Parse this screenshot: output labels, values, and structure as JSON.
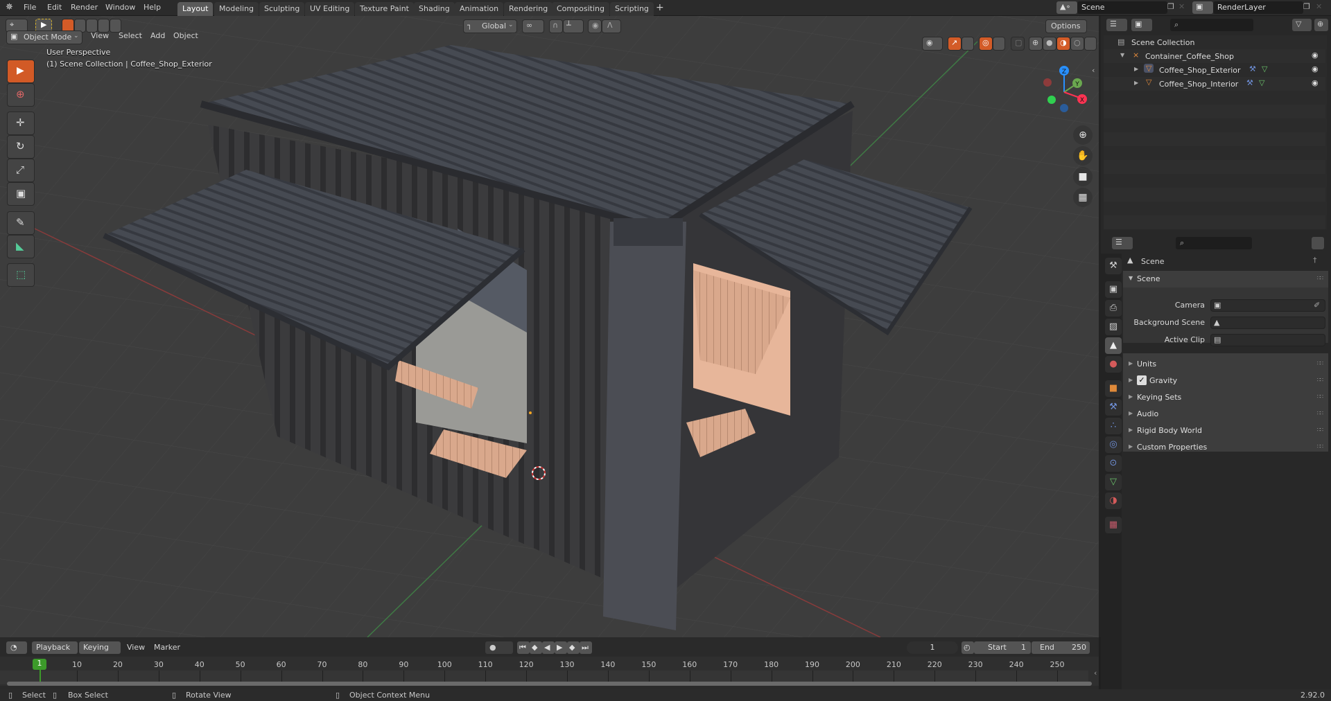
{
  "app": {
    "menu": [
      "File",
      "Edit",
      "Render",
      "Window",
      "Help"
    ],
    "workspaces": [
      "Layout",
      "Modeling",
      "Sculpting",
      "UV Editing",
      "Texture Paint",
      "Shading",
      "Animation",
      "Rendering",
      "Compositing",
      "Scripting"
    ],
    "active_workspace": "Layout",
    "add_workspace": "+",
    "scene_name": "Scene",
    "view_layer_name": "RenderLayer",
    "version": "2.92.0"
  },
  "viewport": {
    "mode": "Object Mode",
    "menus": [
      "View",
      "Select",
      "Add",
      "Object"
    ],
    "transform_orientation": "Global",
    "options_label": "Options",
    "overlay_line1": "User Perspective",
    "overlay_line2": "(1) Scene Collection | Coffee_Shop_Exterior",
    "gizmo_axes": {
      "x": "X",
      "y": "Y",
      "z": "Z"
    },
    "axis_colors": {
      "x": "#ff3352",
      "y": "#8bdc00",
      "z": "#2890ff"
    },
    "tools": [
      "select-box",
      "cursor",
      "move",
      "rotate",
      "scale",
      "transform",
      "annotate",
      "measure",
      "add-cube"
    ],
    "active_tool": "select-box",
    "nav_buttons": [
      "zoom",
      "pan",
      "camera-view",
      "ortho-toggle"
    ],
    "shading_mode": "material-preview"
  },
  "outliner": {
    "root": "Scene Collection",
    "items": [
      {
        "name": "Container_Coffee_Shop",
        "type": "empty",
        "expanded": true,
        "visible": true
      },
      {
        "name": "Coffee_Shop_Exterior",
        "type": "mesh",
        "expanded": false,
        "visible": true,
        "selected": true
      },
      {
        "name": "Coffee_Shop_Interior",
        "type": "mesh",
        "expanded": false,
        "visible": true
      }
    ]
  },
  "properties": {
    "context_title": "Scene",
    "panel_title": "Scene",
    "fields": [
      {
        "label": "Camera",
        "value": ""
      },
      {
        "label": "Background Scene",
        "value": ""
      },
      {
        "label": "Active Clip",
        "value": ""
      }
    ],
    "sub_panels": [
      "Units",
      "Gravity",
      "Keying Sets",
      "Audio",
      "Rigid Body World",
      "Custom Properties"
    ],
    "gravity_checked": true,
    "tabs": [
      "tool",
      "render",
      "output",
      "view-layer",
      "scene",
      "world",
      "object",
      "modifiers",
      "particles",
      "physics",
      "constraints",
      "data",
      "material",
      "texture"
    ],
    "active_tab": "scene"
  },
  "timeline": {
    "menus": [
      "Playback",
      "Keying",
      "View",
      "Marker"
    ],
    "current_frame": "1",
    "start_label": "Start",
    "start": "1",
    "end_label": "End",
    "end": "250",
    "ticks": [
      "10",
      "20",
      "30",
      "40",
      "50",
      "60",
      "70",
      "80",
      "90",
      "100",
      "110",
      "120",
      "130",
      "140",
      "150",
      "160",
      "170",
      "180",
      "190",
      "200",
      "210",
      "220",
      "230",
      "240",
      "250"
    ],
    "playhead_label": "1"
  },
  "statusbar": {
    "select": "Select",
    "box_select": "Box Select",
    "rotate_view": "Rotate View",
    "context_menu": "Object Context Menu"
  }
}
